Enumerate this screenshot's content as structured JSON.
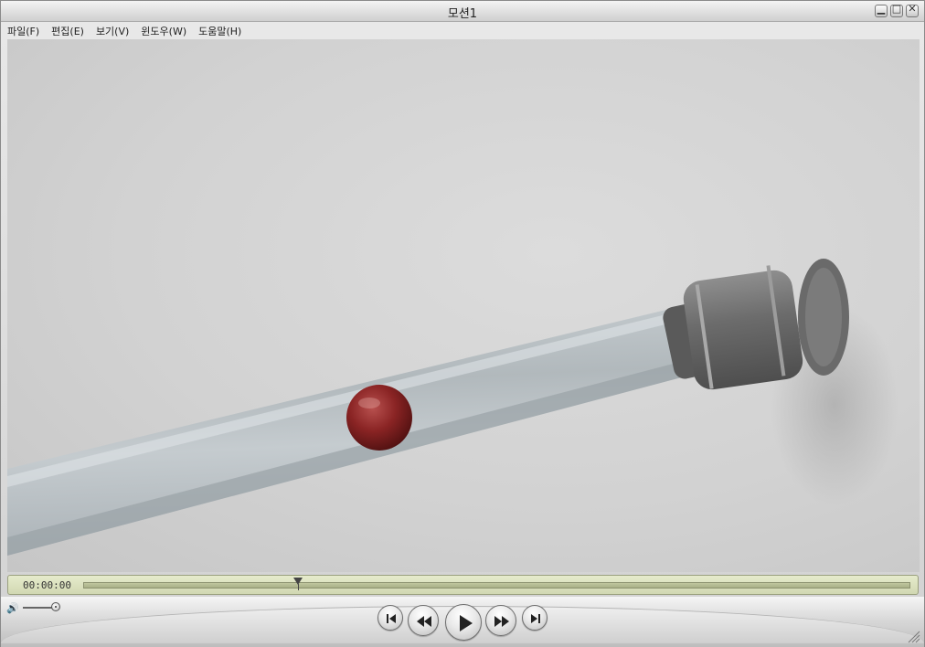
{
  "window": {
    "title": "모션1"
  },
  "menu": [
    {
      "label": "파일(F)"
    },
    {
      "label": "편집(E)"
    },
    {
      "label": "보기(V)"
    },
    {
      "label": "윈도우(W)"
    },
    {
      "label": "도움말(H)"
    }
  ],
  "player": {
    "timecode": "00:00:00",
    "playhead_fraction": 0.26,
    "volume_fraction": 0.9
  },
  "icons": {
    "minimize": "minimize-icon",
    "maximize": "maximize-icon",
    "close": "close-icon",
    "volume": "speaker-icon",
    "skip_start": "skip-to-start-icon",
    "rewind": "rewind-icon",
    "play": "play-icon",
    "fast_forward": "fast-forward-icon",
    "skip_end": "skip-to-end-icon",
    "resize": "resize-grip-icon"
  }
}
